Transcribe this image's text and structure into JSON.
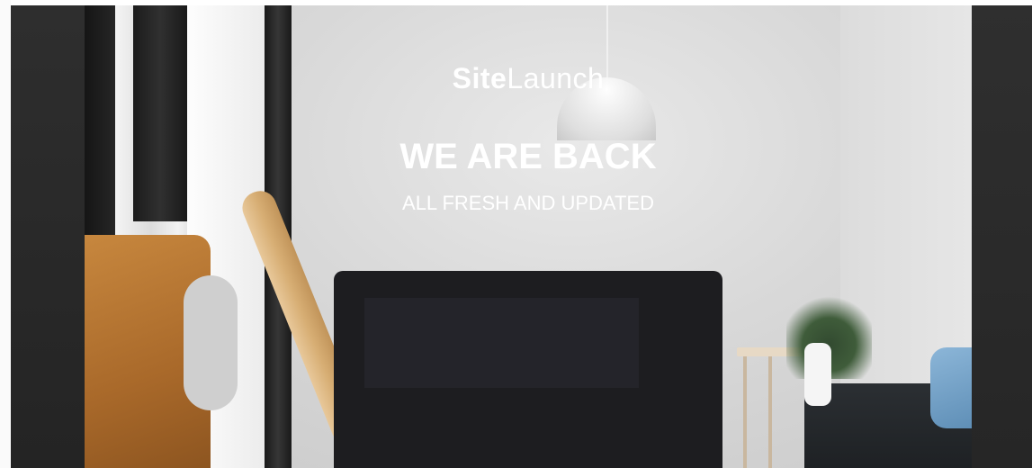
{
  "brand": {
    "part1": "Site",
    "part2": "Launch"
  },
  "hero": {
    "headline": "WE ARE BACK",
    "subline": "ALL FRESH AND UPDATED"
  },
  "colors": {
    "text": "#ffffff",
    "background_dark": "#2a2a2a"
  }
}
